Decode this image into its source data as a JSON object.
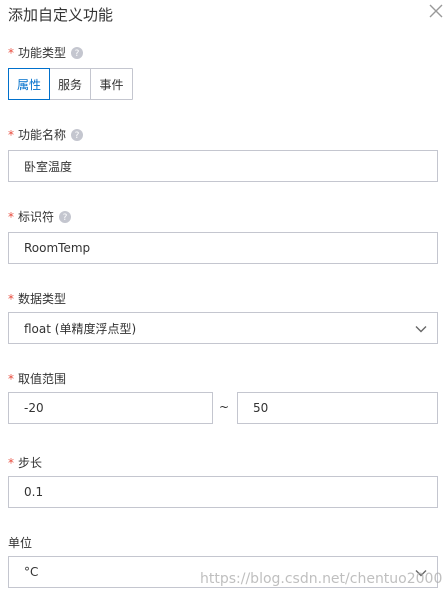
{
  "dialog": {
    "title": "添加自定义功能"
  },
  "fields": {
    "function_type": {
      "label": "功能类型",
      "required_mark": "*",
      "options": [
        "属性",
        "服务",
        "事件"
      ],
      "selected": "属性"
    },
    "function_name": {
      "label": "功能名称",
      "required_mark": "*",
      "value": "卧室温度"
    },
    "identifier": {
      "label": "标识符",
      "required_mark": "*",
      "value": "RoomTemp"
    },
    "data_type": {
      "label": "数据类型",
      "required_mark": "*",
      "value": "float (单精度浮点型)"
    },
    "value_range": {
      "label": "取值范围",
      "required_mark": "*",
      "min": "-20",
      "separator": "~",
      "max": "50"
    },
    "step": {
      "label": "步长",
      "required_mark": "*",
      "value": "0.1"
    },
    "unit": {
      "label": "单位",
      "value": "°C"
    }
  },
  "watermark": "https://blog.csdn.net/chentuo2000",
  "colors": {
    "accent": "#0070cc",
    "required": "#e84c3d",
    "border": "#c4c6cf"
  },
  "icons": [
    "close-icon",
    "help-icon",
    "chevron-down-icon"
  ]
}
